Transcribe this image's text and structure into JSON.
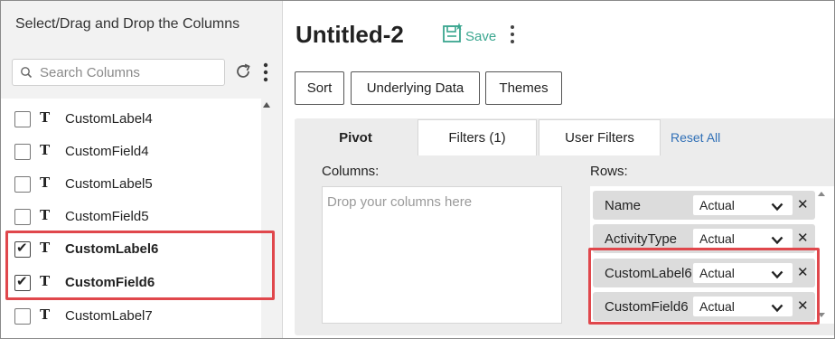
{
  "left_panel": {
    "header": "Select/Drag and Drop the Columns",
    "search_placeholder": "Search Columns",
    "items": [
      {
        "label": "CustomLabel4",
        "checked": false
      },
      {
        "label": "CustomField4",
        "checked": false
      },
      {
        "label": "CustomLabel5",
        "checked": false
      },
      {
        "label": "CustomField5",
        "checked": false
      },
      {
        "label": "CustomLabel6",
        "checked": true
      },
      {
        "label": "CustomField6",
        "checked": true
      },
      {
        "label": "CustomLabel7",
        "checked": false
      }
    ],
    "type_glyph": "T",
    "check_glyph": "✔"
  },
  "report": {
    "title": "Untitled-2",
    "save_label": "Save"
  },
  "toolbar": {
    "sort": "Sort",
    "underlying_data": "Underlying Data",
    "themes": "Themes"
  },
  "tabs": {
    "pivot": "Pivot",
    "filters": "Filters (1)",
    "user_filters": "User Filters",
    "reset_all": "Reset All"
  },
  "pivot": {
    "columns_label": "Columns:",
    "columns_placeholder": "Drop your columns here",
    "rows_label": "Rows:",
    "rows": [
      {
        "name": "Name",
        "agg": "Actual"
      },
      {
        "name": "ActivityType",
        "agg": "Actual"
      },
      {
        "name": "CustomLabel6",
        "agg": "Actual"
      },
      {
        "name": "CustomField6",
        "agg": "Actual"
      }
    ],
    "remove_glyph": "✕"
  },
  "colors": {
    "highlight": "#e0474c",
    "save_accent": "#3aa68f",
    "link": "#2f6fb6"
  }
}
